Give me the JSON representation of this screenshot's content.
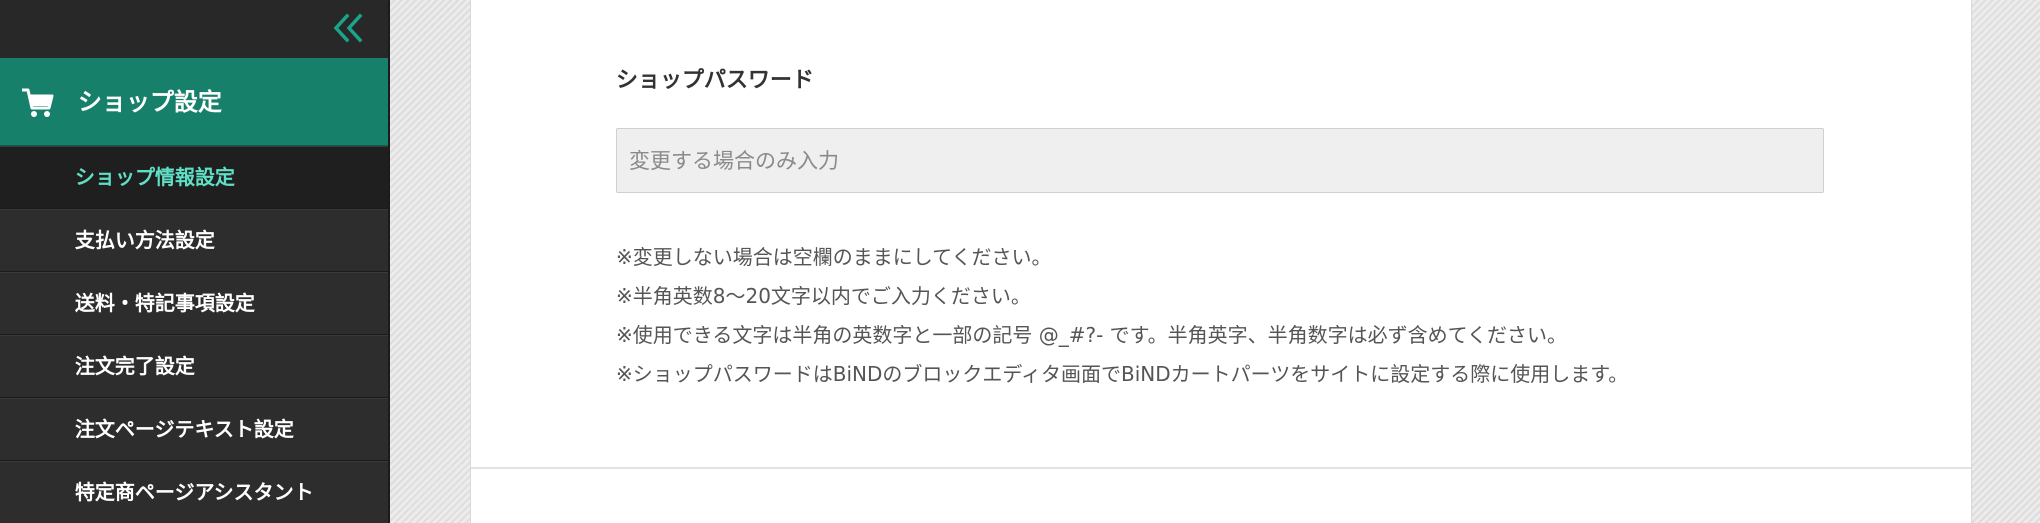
{
  "sidebar": {
    "collapse_icon": "double-chevron-left-icon",
    "section": {
      "icon": "cart-icon",
      "title": "ショップ設定"
    },
    "items": [
      {
        "label": "ショップ情報設定",
        "active": true
      },
      {
        "label": "支払い方法設定",
        "active": false
      },
      {
        "label": "送料・特記事項設定",
        "active": false
      },
      {
        "label": "注文完了設定",
        "active": false
      },
      {
        "label": "注文ページテキスト設定",
        "active": false
      },
      {
        "label": "特定商ページアシスタント",
        "active": false
      }
    ]
  },
  "main": {
    "field_label": "ショップパスワード",
    "password": {
      "value": "",
      "placeholder": "変更する場合のみ入力"
    },
    "notes": [
      "※変更しない場合は空欄のままにしてください。",
      "※半角英数8〜20文字以内でご入力ください。",
      "※使用できる文字は半角の英数字と一部の記号 @_#?- です。半角英字、半角数字は必ず含めてください。",
      "※ショップパスワードはBiNDのブロックエディタ画面でBiNDカートパーツをサイトに設定する際に使用します。"
    ]
  },
  "colors": {
    "accent": "#17806a",
    "active_text": "#5fe0c6",
    "sidebar_bg": "#2d2d2d"
  }
}
